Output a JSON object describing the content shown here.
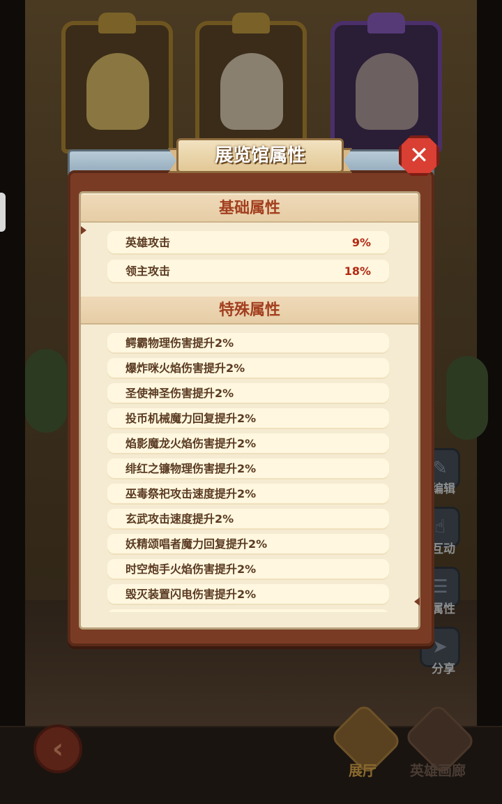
{
  "dialog": {
    "title": "展览馆属性",
    "close_glyph": "✕"
  },
  "basic": {
    "title": "基础属性",
    "rows": [
      {
        "name": "英雄攻击",
        "value": "9%"
      },
      {
        "name": "领主攻击",
        "value": "18%"
      }
    ]
  },
  "special": {
    "title": "特殊属性",
    "rows": [
      "鳄霸物理伤害提升2%",
      "爆炸咪火焰伤害提升2%",
      "圣使神圣伤害提升2%",
      "投币机械魔力回复提升2%",
      "焰影魔龙火焰伤害提升2%",
      "绯红之镰物理伤害提升2%",
      "巫毒祭祀攻击速度提升2%",
      "玄武攻击速度提升2%",
      "妖精颂唱者魔力回复提升2%",
      "时空炮手火焰伤害提升2%",
      "毁灭装置闪电伤害提升2%"
    ]
  },
  "side_menu": [
    {
      "label": "编辑",
      "icon": "edit-icon"
    },
    {
      "label": "互动",
      "icon": "thumbs-up-icon"
    },
    {
      "label": "属性",
      "icon": "list-icon"
    },
    {
      "label": "分享",
      "icon": "share-icon"
    }
  ],
  "bottom_nav": {
    "back_icon": "back-arrow-icon",
    "hall_label": "展厅",
    "gallery_label": "英雄画廊"
  },
  "colors": {
    "panel_brown": "#7a3b24",
    "parchment": "#f5ebd2",
    "value_red": "#b22a16",
    "close_red": "#d93f33"
  }
}
